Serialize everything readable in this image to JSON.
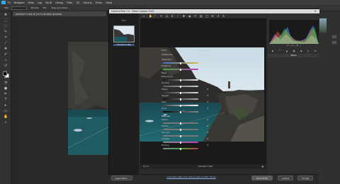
{
  "photoshop": {
    "menu": [
      "Fil",
      "Redigere",
      "Bilde",
      "Lag",
      "Skrift",
      "Utvalg",
      "Filter",
      "3D",
      "Visning",
      "Vindu",
      "Hjelp"
    ],
    "document_tab": "DSC00077.ARW @ 16,7% (RGB/8) (Mottatt)",
    "options": [
      "Mat:",
      "Normal",
      "Stil:",
      "Velg og masker..."
    ]
  },
  "camera_raw": {
    "title": "Camera Raw 7.0 - Nikon Coolpix 4700",
    "filmstrip_label": "Film",
    "filmstrip_item": "DSC00077.ARW",
    "histogram_info": "R: --- G: --- B: ---",
    "basic_header": "Basis",
    "profile_label": "Profil",
    "profile_value": "Adobe-farge",
    "white_balance_label": "Hvitbalanse:",
    "white_balance_value": "Som tatt",
    "sliders_group1": [
      {
        "label": "Temperatur",
        "value": "0"
      },
      {
        "label": "Fargetone",
        "value": "0"
      }
    ],
    "tone_header": "Tone",
    "sliders_group2": [
      {
        "label": "Eksponering",
        "value": "0,00"
      },
      {
        "label": "Kontrast",
        "value": "0"
      },
      {
        "label": "Høylys",
        "value": "0"
      },
      {
        "label": "Skygger",
        "value": "0"
      },
      {
        "label": "Hvitt",
        "value": "0"
      },
      {
        "label": "Svart",
        "value": "0"
      }
    ],
    "presence_header": "Nærvær",
    "sliders_group3": [
      {
        "label": "Tekstur",
        "value": "0"
      },
      {
        "label": "Klarhet",
        "value": "0"
      },
      {
        "label": "Fjern dis",
        "value": "0"
      },
      {
        "label": "Livlighet",
        "value": "0"
      },
      {
        "label": "Metning",
        "value": "0"
      }
    ],
    "zoom": "16,7%",
    "preview_filename": "DSC00077.ARW",
    "buttons": {
      "cancel": "Avbryt",
      "open": "Åpne bilde",
      "done": "Ferdig",
      "save": "Lagre bilde..."
    },
    "info_link": "Adobe RGB (1998); 8 bit; 6000 by 4000 (24,0MP); 300 ppi"
  },
  "colors": {
    "sky": "#dfe9ef",
    "water": "#1d5860",
    "rock": "#3a3a38"
  }
}
